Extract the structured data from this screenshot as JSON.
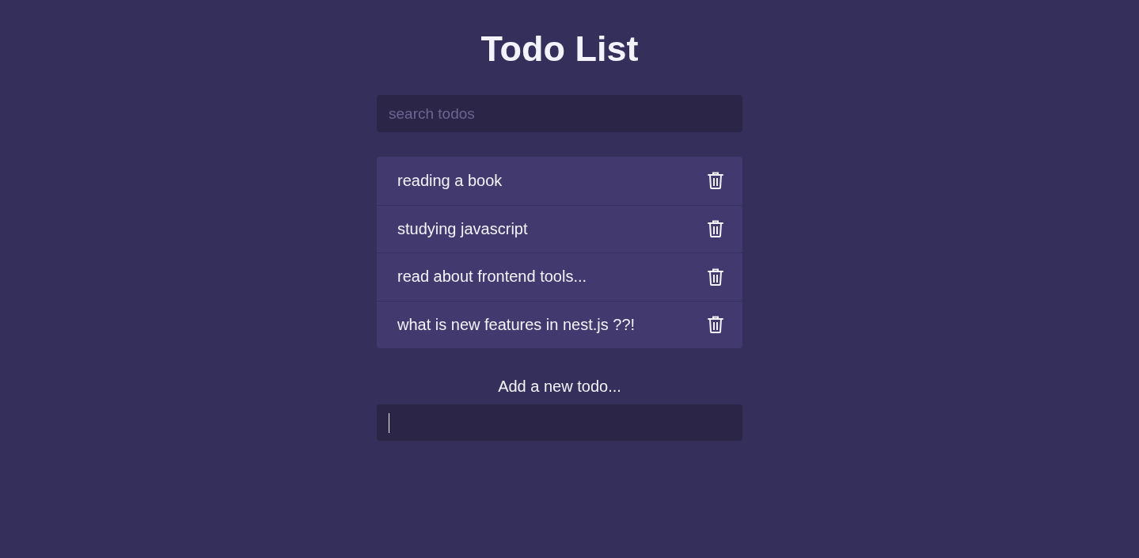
{
  "title": "Todo List",
  "search": {
    "placeholder": "search todos"
  },
  "todos": [
    {
      "text": "reading a book"
    },
    {
      "text": "studying javascript"
    },
    {
      "text": "read about frontend tools..."
    },
    {
      "text": "what is new features in nest.js ??!"
    }
  ],
  "add_form": {
    "label": "Add a new todo...",
    "focused": true
  }
}
